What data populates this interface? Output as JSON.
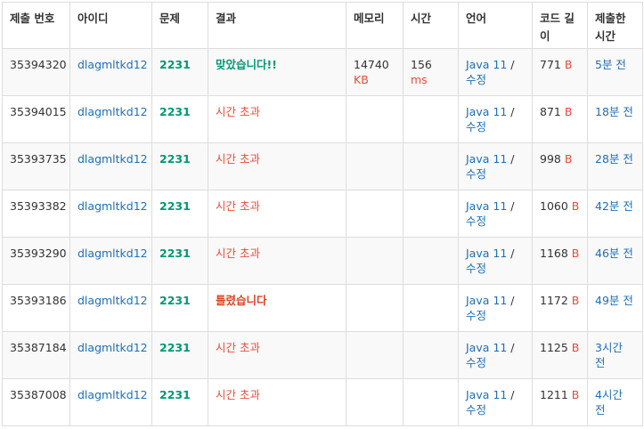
{
  "columns": [
    "제출 번호",
    "아이디",
    "문제",
    "결과",
    "메모리",
    "시간",
    "언어",
    "코드 길이",
    "제출한 시간"
  ],
  "rows": [
    {
      "id": "35394320",
      "user": "dlagmltkd12",
      "problem": "2231",
      "result": "맞았습니다!!",
      "result_type": "ac",
      "memory": "14740",
      "memory_unit": "KB",
      "time": "156",
      "time_unit": "ms",
      "lang": "Java 11",
      "edit": "수정",
      "code_len": "771",
      "code_unit": "B",
      "submitted": "5분 전"
    },
    {
      "id": "35394015",
      "user": "dlagmltkd12",
      "problem": "2231",
      "result": "시간 초과",
      "result_type": "tle",
      "memory": "",
      "memory_unit": "",
      "time": "",
      "time_unit": "",
      "lang": "Java 11",
      "edit": "수정",
      "code_len": "871",
      "code_unit": "B",
      "submitted": "18분 전"
    },
    {
      "id": "35393735",
      "user": "dlagmltkd12",
      "problem": "2231",
      "result": "시간 초과",
      "result_type": "tle",
      "memory": "",
      "memory_unit": "",
      "time": "",
      "time_unit": "",
      "lang": "Java 11",
      "edit": "수정",
      "code_len": "998",
      "code_unit": "B",
      "submitted": "28분 전"
    },
    {
      "id": "35393382",
      "user": "dlagmltkd12",
      "problem": "2231",
      "result": "시간 초과",
      "result_type": "tle",
      "memory": "",
      "memory_unit": "",
      "time": "",
      "time_unit": "",
      "lang": "Java 11",
      "edit": "수정",
      "code_len": "1060",
      "code_unit": "B",
      "submitted": "42분 전"
    },
    {
      "id": "35393290",
      "user": "dlagmltkd12",
      "problem": "2231",
      "result": "시간 초과",
      "result_type": "tle",
      "memory": "",
      "memory_unit": "",
      "time": "",
      "time_unit": "",
      "lang": "Java 11",
      "edit": "수정",
      "code_len": "1168",
      "code_unit": "B",
      "submitted": "46분 전"
    },
    {
      "id": "35393186",
      "user": "dlagmltkd12",
      "problem": "2231",
      "result": "틀렸습니다",
      "result_type": "wa",
      "memory": "",
      "memory_unit": "",
      "time": "",
      "time_unit": "",
      "lang": "Java 11",
      "edit": "수정",
      "code_len": "1172",
      "code_unit": "B",
      "submitted": "49분 전"
    },
    {
      "id": "35387184",
      "user": "dlagmltkd12",
      "problem": "2231",
      "result": "시간 초과",
      "result_type": "tle",
      "memory": "",
      "memory_unit": "",
      "time": "",
      "time_unit": "",
      "lang": "Java 11",
      "edit": "수정",
      "code_len": "1125",
      "code_unit": "B",
      "submitted": "3시간 전"
    },
    {
      "id": "35387008",
      "user": "dlagmltkd12",
      "problem": "2231",
      "result": "시간 초과",
      "result_type": "tle",
      "memory": "",
      "memory_unit": "",
      "time": "",
      "time_unit": "",
      "lang": "Java 11",
      "edit": "수정",
      "code_len": "1211",
      "code_unit": "B",
      "submitted": "4시간 전"
    }
  ],
  "colors": {
    "accepted": "#009874",
    "tle": "#e74c3c",
    "wrong": "#dd4124",
    "link": "#1f6fb5",
    "border": "#dddddd"
  }
}
